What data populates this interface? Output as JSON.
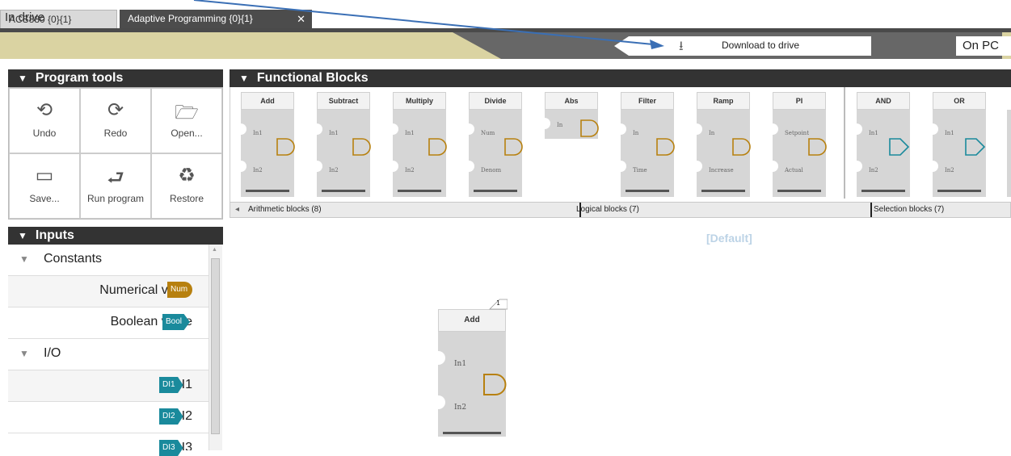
{
  "tabs": [
    {
      "label": "ACS880 {0}{1}"
    },
    {
      "label": "Adaptive Programming {0}{1}",
      "close": "✕"
    }
  ],
  "status": {
    "left": "In drive",
    "download_label": "Download to drive",
    "right": "On PC"
  },
  "program_tools": {
    "title": "Program tools",
    "items": [
      {
        "label": "Undo",
        "icon": "undo-icon"
      },
      {
        "label": "Redo",
        "icon": "redo-icon"
      },
      {
        "label": "Open...",
        "icon": "folder-open-icon"
      },
      {
        "label": "Save...",
        "icon": "save-icon"
      },
      {
        "label": "Run program",
        "icon": "run-icon"
      },
      {
        "label": "Restore",
        "icon": "restore-icon"
      }
    ]
  },
  "functional_blocks": {
    "title": "Functional Blocks",
    "blocks": [
      {
        "name": "Add",
        "pins": [
          "In1",
          "In2"
        ],
        "kind": "arith"
      },
      {
        "name": "Subtract",
        "pins": [
          "In1",
          "In2"
        ],
        "kind": "arith"
      },
      {
        "name": "Multiply",
        "pins": [
          "In1",
          "In2"
        ],
        "kind": "arith"
      },
      {
        "name": "Divide",
        "pins": [
          "Num",
          "Denom"
        ],
        "kind": "arith"
      },
      {
        "name": "Abs",
        "pins": [
          "In"
        ],
        "kind": "arith"
      },
      {
        "name": "Filter",
        "pins": [
          "In",
          "Time"
        ],
        "kind": "arith"
      },
      {
        "name": "Ramp",
        "pins": [
          "In",
          "Increase"
        ],
        "kind": "arith"
      },
      {
        "name": "PI",
        "pins": [
          "Setpoint",
          "Actual"
        ],
        "kind": "arith"
      },
      {
        "name": "AND",
        "pins": [
          "In1",
          "In2"
        ],
        "kind": "logic"
      },
      {
        "name": "OR",
        "pins": [
          "In1",
          "In2"
        ],
        "kind": "logic"
      }
    ],
    "categories": [
      "Arithmetic blocks (8)",
      "Logical blocks (7)",
      "Selection blocks (7)"
    ],
    "colors": {
      "arith": "#b7800f",
      "logic": "#1a8a9c"
    }
  },
  "inputs": {
    "title": "Inputs",
    "groups": [
      {
        "label": "Constants"
      },
      {
        "label": "I/O"
      }
    ],
    "constants": [
      {
        "label": "Numerical value",
        "chip": "Num"
      },
      {
        "label": "Boolean value",
        "chip": "Bool"
      }
    ],
    "io": [
      {
        "label": "DI1",
        "chip": "DI1"
      },
      {
        "label": "DI2",
        "chip": "DI2"
      },
      {
        "label": "DI3",
        "chip": "DI3"
      }
    ]
  },
  "canvas": {
    "label": "[Default]",
    "block": {
      "name": "Add",
      "number": "1",
      "pins": [
        "In1",
        "In2"
      ]
    }
  }
}
